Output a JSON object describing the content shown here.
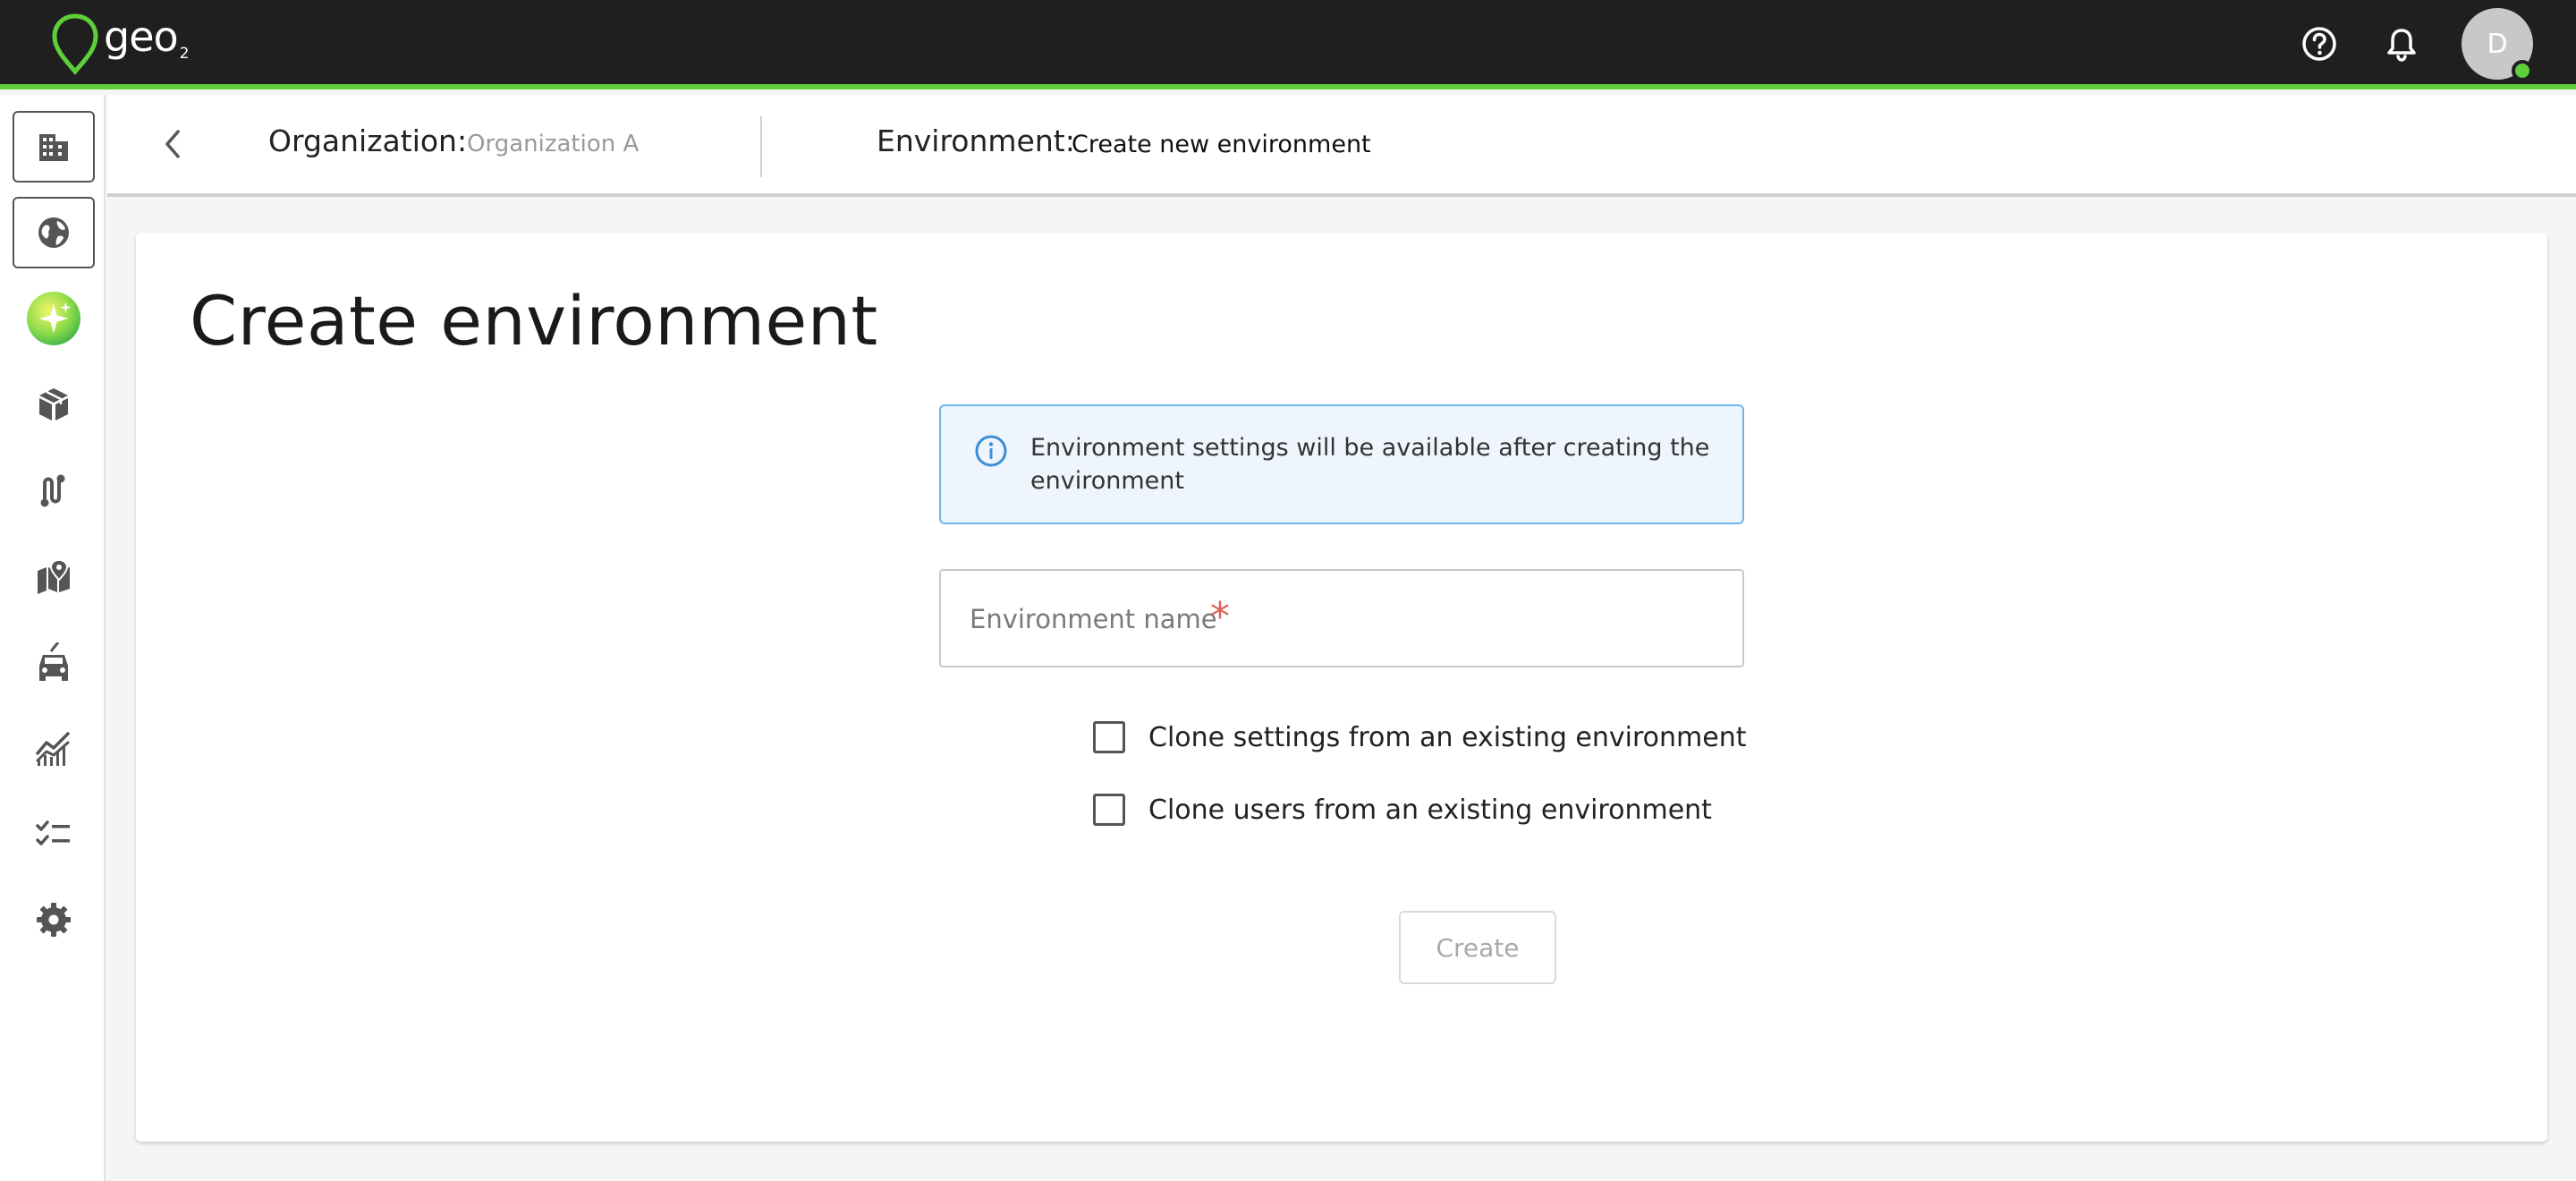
{
  "app": {
    "logo_text": "geo",
    "logo_sub": "2",
    "brand_color": "#5ecf3a"
  },
  "topbar": {
    "help_icon": "help-circle-icon",
    "notifications_icon": "bell-icon",
    "avatar_initial": "D",
    "avatar_status": "online"
  },
  "sidebar": {
    "items": [
      {
        "name": "organization",
        "icon": "building-icon",
        "selected": true
      },
      {
        "name": "environment",
        "icon": "globe-icon",
        "selected": true
      },
      {
        "name": "ai-assistant",
        "icon": "sparkle-icon",
        "selected": false
      },
      {
        "name": "packages",
        "icon": "box-icon",
        "selected": false
      },
      {
        "name": "routes",
        "icon": "route-icon",
        "selected": false
      },
      {
        "name": "map",
        "icon": "map-pin-icon",
        "selected": false
      },
      {
        "name": "vehicles",
        "icon": "car-icon",
        "selected": false
      },
      {
        "name": "analytics",
        "icon": "chart-icon",
        "selected": false
      },
      {
        "name": "tasks",
        "icon": "checklist-icon",
        "selected": false
      },
      {
        "name": "settings",
        "icon": "gear-icon",
        "selected": false
      }
    ]
  },
  "breadcrumb": {
    "org_label": "Organization:",
    "org_value": "Organization A",
    "env_label": "Environment:",
    "env_value": "Create new environment"
  },
  "main": {
    "title": "Create environment",
    "info_text": "Environment settings will be available after creating the environment",
    "name_placeholder": "Environment name",
    "required_mark": "*",
    "clone_settings_label": "Clone settings from an existing environment",
    "clone_users_label": "Clone users from an existing environment",
    "clone_settings_checked": false,
    "clone_users_checked": false,
    "create_label": "Create",
    "create_enabled": false
  }
}
